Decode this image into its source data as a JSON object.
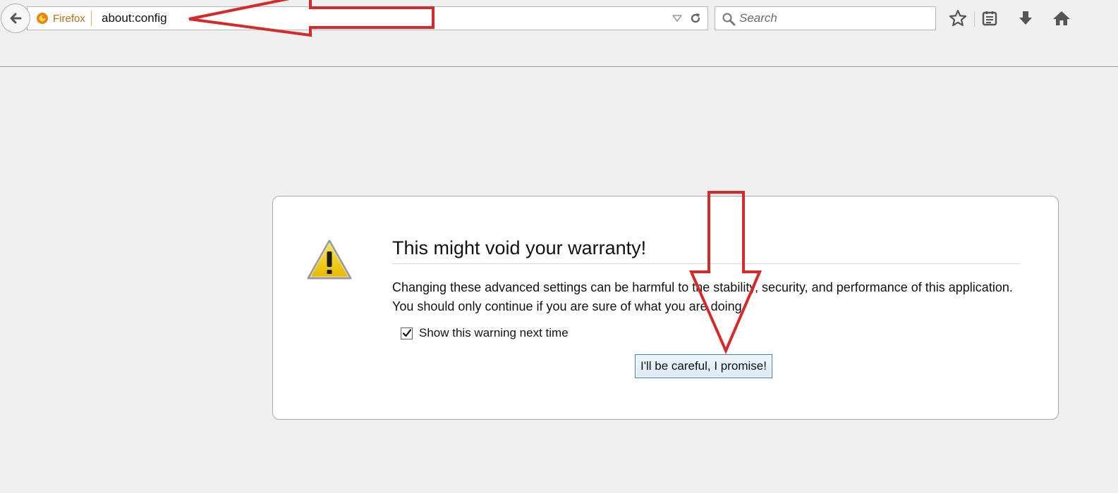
{
  "browser": {
    "identity_label": "Firefox",
    "url": "about:config",
    "search_placeholder": "Search"
  },
  "warning": {
    "title": "This might void your warranty!",
    "message": "Changing these advanced settings can be harmful to the stability, security, and performance of this application. You should only continue if you are sure of what you are doing.",
    "checkbox_label": "Show this warning next time",
    "checkbox_checked": true,
    "button_label": "I'll be careful, I promise!"
  },
  "icons": {
    "back": "back-arrow-icon",
    "identity": "firefox-icon",
    "dropmarker": "dropdown-triangle-icon",
    "reload": "reload-icon",
    "search": "search-icon",
    "bookmark": "star-icon",
    "reading_list": "reading-list-icon",
    "downloads": "download-arrow-icon",
    "home": "home-icon",
    "warning": "warning-triangle-icon"
  },
  "colors": {
    "annotation_red": "#d42a2a",
    "identity_orange": "#b86f16",
    "warning_yellow": "#f3d112"
  }
}
